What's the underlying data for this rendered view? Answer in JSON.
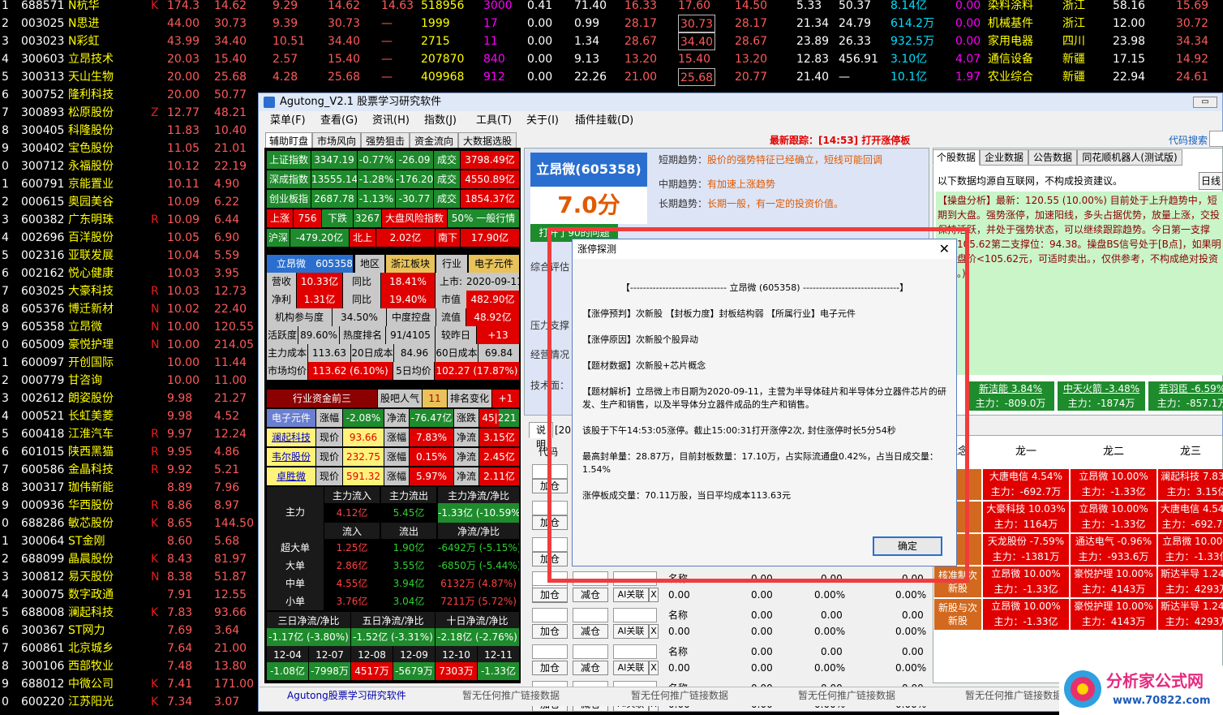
{
  "stock_list": [
    [
      "688571",
      "N杭华",
      "K",
      "174.3",
      "14.62",
      "9.29",
      "14.62",
      "14.63",
      "518956",
      "3000",
      "0.41",
      "71.40",
      "16.33",
      "17.60",
      "14.50",
      "5.33",
      "50.37",
      "8.14亿",
      "0.00",
      "染料涂料",
      "浙江",
      "58.16",
      "15.69"
    ],
    [
      "003025",
      "N思进",
      "",
      "44.00",
      "30.73",
      "9.39",
      "30.73",
      "—",
      "1999",
      "17",
      "0.00",
      "0.99",
      "28.17",
      "30.73",
      "28.17",
      "21.34",
      "24.79",
      "614.2万",
      "0.00",
      "机械基件",
      "浙江",
      "12.00",
      "30.72"
    ],
    [
      "003023",
      "N彩虹",
      "",
      "43.99",
      "34.40",
      "10.51",
      "34.40",
      "—",
      "2715",
      "11",
      "0.00",
      "1.34",
      "28.67",
      "34.40",
      "28.67",
      "23.89",
      "26.33",
      "932.5万",
      "0.00",
      "家用电器",
      "四川",
      "23.98",
      "34.34"
    ],
    [
      "300603",
      "立昂技术",
      "",
      "20.03",
      "15.40",
      "2.57",
      "15.40",
      "—",
      "207870",
      "840",
      "0.00",
      "9.13",
      "13.20",
      "15.40",
      "13.20",
      "12.83",
      "456.91",
      "3.10亿",
      "4.07",
      "通信设备",
      "新疆",
      "17.15",
      "14.92"
    ],
    [
      "300313",
      "天山生物",
      "",
      "20.00",
      "25.68",
      "4.28",
      "25.68",
      "—",
      "409968",
      "912",
      "0.00",
      "22.26",
      "21.00",
      "25.68",
      "20.77",
      "21.40",
      "—",
      "10.1亿",
      "1.97",
      "农业综合",
      "新疆",
      "22.94",
      "24.61"
    ],
    [
      "300752",
      "隆利科技",
      "",
      "20.00",
      "50.77"
    ],
    [
      "300893",
      "松原股份",
      "Z",
      "12.77",
      "48.21"
    ],
    [
      "300405",
      "科隆股份",
      "",
      "11.83",
      "10.40"
    ],
    [
      "300402",
      "宝色股份",
      "",
      "11.05",
      "21.01"
    ],
    [
      "300712",
      "永福股份",
      "",
      "10.12",
      "22.19"
    ],
    [
      "600791",
      "京能置业",
      "",
      "10.11",
      "4.90"
    ],
    [
      "000615",
      "奥园美谷",
      "",
      "10.09",
      "6.22"
    ],
    [
      "600382",
      "广东明珠",
      "R",
      "10.09",
      "6.44"
    ],
    [
      "002696",
      "百洋股份",
      "",
      "10.05",
      "6.90"
    ],
    [
      "002316",
      "亚联发展",
      "",
      "10.04",
      "5.59"
    ],
    [
      "002162",
      "悦心健康",
      "",
      "10.03",
      "3.95"
    ],
    [
      "603025",
      "大豪科技",
      "R",
      "10.03",
      "12.73"
    ],
    [
      "605376",
      "博迁新材",
      "N",
      "10.02",
      "22.40"
    ],
    [
      "605358",
      "立昂微",
      "N",
      "10.00",
      "120.55"
    ],
    [
      "605009",
      "豪悦护理",
      "N",
      "10.00",
      "214.05"
    ],
    [
      "600097",
      "开创国际",
      "",
      "10.00",
      "11.44"
    ],
    [
      "000779",
      "甘咨询",
      "",
      "10.00",
      "11.00"
    ],
    [
      "002612",
      "朗姿股份",
      "",
      "9.98",
      "21.27"
    ],
    [
      "000521",
      "长虹美菱",
      "",
      "9.98",
      "4.52"
    ],
    [
      "600418",
      "江淮汽车",
      "R",
      "9.97",
      "12.24"
    ],
    [
      "601015",
      "陕西黑猫",
      "R",
      "9.95",
      "4.86"
    ],
    [
      "600586",
      "金晶科技",
      "R",
      "9.92",
      "5.21"
    ],
    [
      "300317",
      "珈伟新能",
      "",
      "8.89",
      "7.96"
    ],
    [
      "000936",
      "华西股份",
      "R",
      "8.86",
      "8.97"
    ],
    [
      "688286",
      "敏芯股份",
      "K",
      "8.65",
      "144.50"
    ],
    [
      "300064",
      "ST金刚",
      "",
      "8.60",
      "5.68"
    ],
    [
      "688099",
      "晶晨股份",
      "K",
      "8.43",
      "81.97"
    ],
    [
      "300812",
      "易天股份",
      "N",
      "8.38",
      "51.87"
    ],
    [
      "300075",
      "数字政通",
      "",
      "7.91",
      "12.55"
    ],
    [
      "688008",
      "澜起科技",
      "K",
      "7.83",
      "93.66"
    ],
    [
      "300367",
      "ST网力",
      "",
      "7.69",
      "3.64"
    ],
    [
      "600861",
      "北京城乡",
      "",
      "7.64",
      "21.00"
    ],
    [
      "300106",
      "西部牧业",
      "",
      "7.48",
      "13.80"
    ],
    [
      "688012",
      "中微公司",
      "K",
      "7.41",
      "171.00"
    ],
    [
      "600220",
      "江苏阳光",
      "K",
      "7.34",
      "3.07"
    ]
  ],
  "window": {
    "title": "Agutong_V2.1 股票学习研究软件"
  },
  "menu": [
    "菜单(F)",
    "查看(G)",
    "资讯(H)",
    "指数(J)",
    "工具(T)",
    "关于(I)",
    "插件挂载(D)"
  ],
  "left_tabs": [
    "辅助盯盘",
    "市场风向",
    "强势狙击",
    "资金流向",
    "大数据选股"
  ],
  "latest_track": "最新跟踪：[14:53] 打开涨停板",
  "code_search": "代码搜索",
  "index_rows": [
    [
      "上证指数",
      "3347.19",
      "-0.77%",
      "-26.09",
      "成交",
      "3798.49亿"
    ],
    [
      "深成指数",
      "13555.14",
      "-1.28%",
      "-176.20",
      "成交",
      "4550.89亿"
    ],
    [
      "创业板指",
      "2687.78",
      "-1.13%",
      "-30.77",
      "成交",
      "1854.37亿"
    ]
  ],
  "updown": {
    "up_label": "上涨",
    "up": "756",
    "down_label": "下跌",
    "down": "3267",
    "risk_label": "大盘风险指数",
    "risk": "50% 一般行情"
  },
  "northsouth": {
    "hushen": "沪深",
    "hs_val": "-479.20亿",
    "north": "北上",
    "n_val": "2.02亿",
    "south": "南下",
    "s_val": "17.90亿"
  },
  "stock_info": {
    "name": "立昂微",
    "code": "605358",
    "region": "地区",
    "region_val": "浙江板块",
    "industry": "行业",
    "industry_val": "电子元件",
    "rev_label": "营收",
    "rev": "10.33亿",
    "yoy_label": "同比",
    "rev_yoy": "18.41%",
    "listed_label": "上市:",
    "listed": "2020-09-11",
    "np_label": "净利",
    "np": "1.31亿",
    "np_yoy": "19.40%",
    "mv_label": "市值",
    "mv": "482.90亿",
    "inst_label": "机构参与度",
    "inst": "34.50%",
    "ctrl_label": "中度控盘",
    "float_label": "流值",
    "float": "48.92亿",
    "act_label": "活跃度",
    "act": "89.60%",
    "hot_label": "热度排名",
    "hot": "91/4105",
    "vs_label": "较昨日",
    "vs": "+13",
    "cost_label": "主力成本",
    "cost": "113.63",
    "c20_label": "20日成本",
    "c20": "84.96",
    "c60_label": "60日成本",
    "c60": "69.84",
    "avg_label": "市场均价",
    "avg": "113.62 (6.10%)",
    "a5_label": "5日均价",
    "a5": "102.27 (17.87%)"
  },
  "sector": {
    "title": "行业资金前三",
    "bar_label": "股吧人气",
    "bar": "11",
    "rank_label": "排名变化",
    "rank": "+1",
    "row": [
      "电子元件",
      "涨幅",
      "-2.08%",
      "净流",
      "-76.47亿",
      "涨跌",
      "45|221"
    ],
    "stocks": [
      [
        "澜起科技",
        "现价",
        "93.66",
        "涨幅",
        "7.83%",
        "净流",
        "3.15亿"
      ],
      [
        "韦尔股份",
        "现价",
        "232.75",
        "涨幅",
        "0.15%",
        "净流",
        "2.45亿"
      ],
      [
        "卓胜微",
        "现价",
        "591.32",
        "涨幅",
        "5.97%",
        "净流",
        "2.11亿"
      ]
    ]
  },
  "flows": {
    "h1": [
      "主力流入",
      "主力流出",
      "主力净流/净比"
    ],
    "main": [
      "主力",
      "4.12亿",
      "5.45亿",
      "-1.33亿 (-10.59%)"
    ],
    "h2": [
      "流入",
      "流出",
      "净流/净比"
    ],
    "rows": [
      [
        "超大单",
        "1.25亿",
        "1.90亿",
        "-6492万 (-5.15%)"
      ],
      [
        "大单",
        "2.86亿",
        "3.55亿",
        "-6850万 (-5.44%)"
      ],
      [
        "中单",
        "4.55亿",
        "3.94亿",
        "6132万 (4.87%)"
      ],
      [
        "小单",
        "3.76亿",
        "3.04亿",
        "7211万 (5.72%)"
      ]
    ],
    "multi_h": [
      "三日净流/净比",
      "五日净流/净比",
      "十日净流/净比"
    ],
    "multi": [
      "-1.17亿 (-3.80%)",
      "-1.52亿 (-3.31%)",
      "-2.18亿 (-2.76%)"
    ],
    "dates": [
      "12-04",
      "12-07",
      "12-08",
      "12-09",
      "12-10",
      "12-11"
    ],
    "date_vals": [
      "-1.08亿",
      "-7998万",
      "4517万",
      "-5679万",
      "7303万",
      "-1.33亿"
    ]
  },
  "score": {
    "name": "立昂微(605358)",
    "score": "7.0分",
    "btn": "打开了90的问题"
  },
  "trends": {
    "short_label": "短期趋势：",
    "short": "股价的强势特征已经确立，短线可能回调",
    "mid_label": "中期趋势：",
    "mid": "有加速上涨趋势",
    "long_label": "长期趋势：",
    "long": "长期一般，有一定的投资价值。",
    "r1": "综合评估",
    "r2": "压力支撑",
    "r3": "经营情况",
    "r4": "技术面："
  },
  "right_tabs": [
    "个股数据",
    "企业数据",
    "公告数据",
    "同花顺机器人(测试版)"
  ],
  "right_note": "以下数据均源自互联网，不构成投资建议。",
  "right_btn": "日线",
  "analysis": "【操盘分析】最新：120.55 (10.00%) 目前处于上升趋势中，短期到大盘。强势涨停，加速阳线，多头占据优势，放量上涨，交投保持活跃，并处于强势状态，可以继续跟踪趋势。今日第一支撑位：105.62第二支撑位：94.38。操盘BS信号处于[B点]，如果明日收盘价<105.62元，可适时卖出。，仅供参考，不构成绝对投资建议。)",
  "hot_stocks": [
    [
      "新洁能 3.84%",
      "主力：-809.0万"
    ],
    [
      "中天火箭 -3.48%",
      "主力：-1874万"
    ],
    [
      "若羽臣 -6.59%",
      "主力：-857.1万"
    ]
  ],
  "dragon": {
    "headers": [
      "概念",
      "龙一",
      "龙二",
      "龙三"
    ],
    "rows": [
      [
        "",
        "大唐电信 4.54%",
        "主力：-692.7万",
        "立昂微 10.00%",
        "主力：-1.33亿",
        "澜起科技 7.83%",
        "主力：3.15亿"
      ],
      [
        "",
        "大豪科技 10.03%",
        "主力：1164万",
        "立昂微 10.00%",
        "主力：-1.33亿",
        "大唐电信 4.54%",
        "主力：-692.7万"
      ],
      [
        "",
        "天龙股份 -7.59%",
        "主力：-1381万",
        "通达电气 -0.96%",
        "主力：-933.6万",
        "立昂微 10.00%",
        "主力：-1.33亿"
      ],
      [
        "核准制次新股",
        "立昂微 10.00%",
        "主力：-1.33亿",
        "豪悦护理 10.00%",
        "主力：4143万",
        "斯达半导 1.24%",
        "主力：4293万"
      ],
      [
        "新股与次新股",
        "立昂微 10.00%",
        "主力：-1.33亿",
        "豪悦护理 10.00%",
        "主力：4143万",
        "斯达半导 1.24%",
        "主力：4293万"
      ]
    ]
  },
  "mid": {
    "desc_label": "说明",
    "year": "[20",
    "code_label": "代码",
    "name_label": "名称",
    "add": "加仓",
    "reduce": "减仓",
    "ai": "AI关联",
    "x": "X",
    "vals": [
      "0.00",
      "0.00",
      "0.00%",
      "0.00"
    ]
  },
  "dialog": {
    "title": "涨停探测",
    "header": "【------------------------------ 立昂微 (605358) ------------------------------】",
    "l1": "【涨停预判】次新股  【封板力度】封板结构弱  【所属行业】电子元件",
    "l2": "【涨停原因】次新股个股异动",
    "l3": "【题材数据】次新股+芯片概念",
    "l4": "【题材解析】立昂微上市日期为2020-09-11，主营为半导体硅片和半导体分立器件芯片的研发、生产和销售，以及半导体分立器件成品的生产和销售。",
    "l5": "该股于下午14:53:05涨停。截止15:00:31打开涨停2次, 封住涨停时长5分54秒",
    "l6": "最高封单量：28.87万，目前封板数量：17.10万，占实际流通盘0.42%，占当日成交量：1.54%",
    "l7": "涨停板成交量：70.11万股，当日平均成本113.63元",
    "ok": "确定"
  },
  "status": {
    "app": "Agutong股票学习研究软件",
    "promo": "暂无任何推广链接数据"
  },
  "watermark": {
    "text": "分析家公式网",
    "url": "www.70822.com"
  }
}
